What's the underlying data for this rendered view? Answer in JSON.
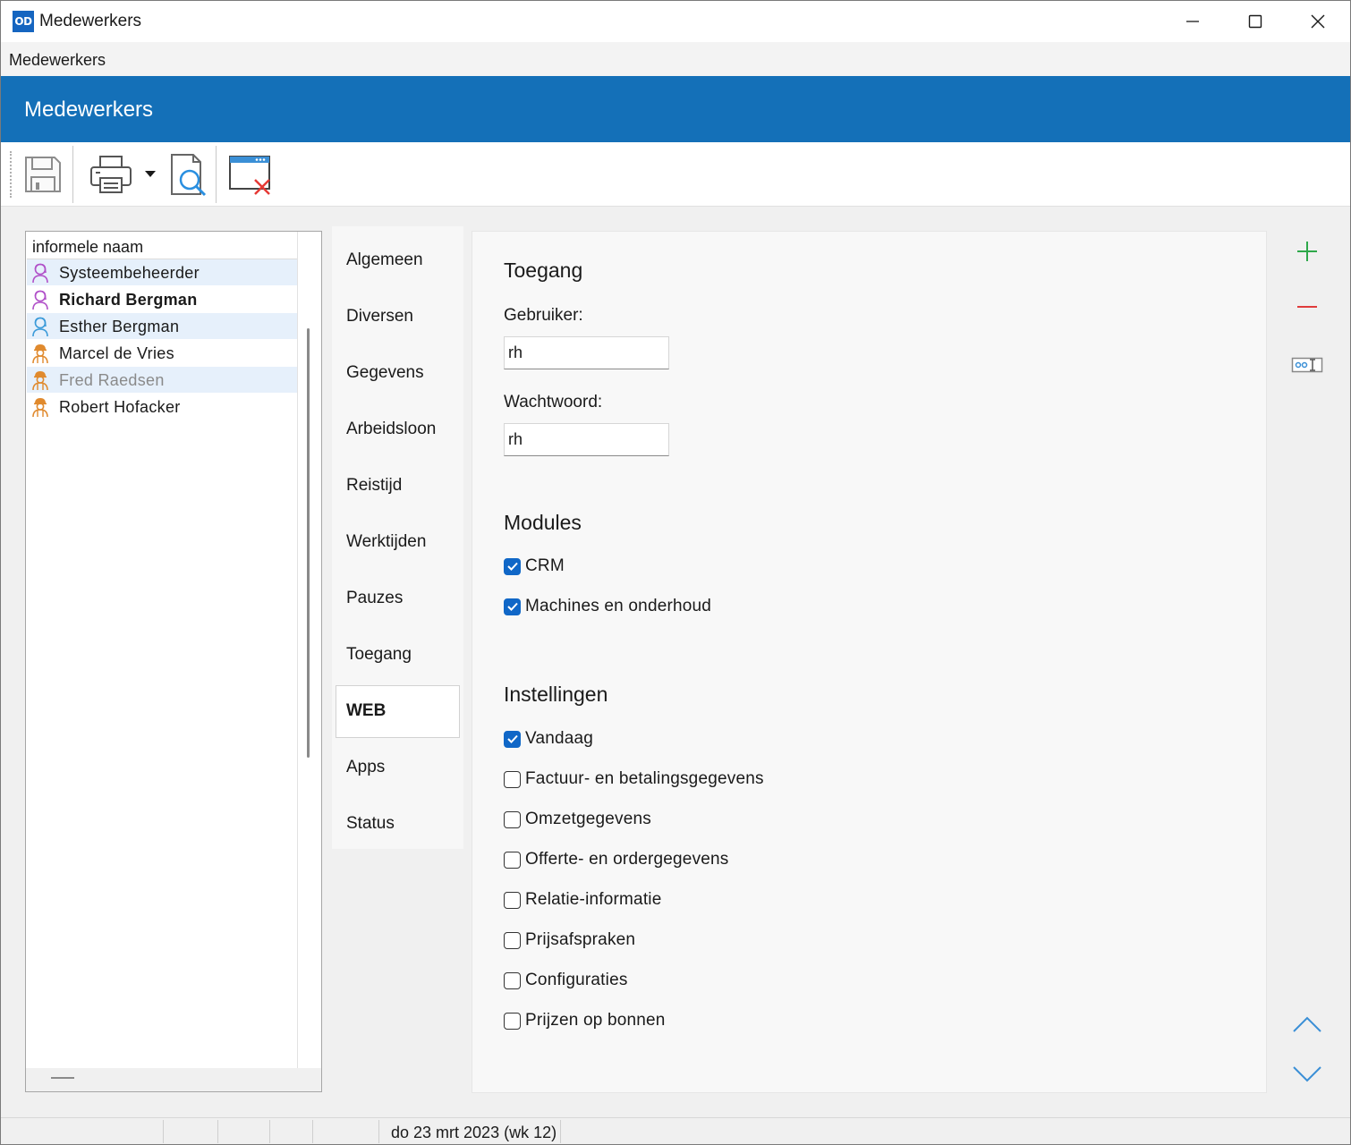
{
  "window": {
    "app_logo": "OD",
    "title": "Medewerkers"
  },
  "menu": {
    "items": [
      "Medewerkers"
    ]
  },
  "header": {
    "title": "Medewerkers"
  },
  "toolbar": {
    "buttons": [
      {
        "name": "save",
        "icon": "save-icon"
      },
      {
        "name": "print",
        "icon": "printer-icon"
      },
      {
        "name": "print-dropdown",
        "icon": "chevron-down-icon"
      },
      {
        "name": "print-preview",
        "icon": "preview-icon"
      },
      {
        "name": "close-window",
        "icon": "close-window-icon"
      }
    ]
  },
  "employee_list": {
    "column_header": "informele naam",
    "rows": [
      {
        "name": "Systeembeheerder",
        "style": "normal",
        "icon_color": "#b04fc8",
        "icon": "person-female-icon"
      },
      {
        "name": "Richard Bergman",
        "style": "bold",
        "icon_color": "#b04fc8",
        "icon": "person-female-icon"
      },
      {
        "name": "Esther Bergman",
        "style": "normal",
        "icon_color": "#3a9ad9",
        "icon": "person-female-icon"
      },
      {
        "name": "Marcel de Vries",
        "style": "normal",
        "icon_color": "#e08a2e",
        "icon": "worker-icon"
      },
      {
        "name": "Fred Raedsen",
        "style": "grey",
        "icon_color": "#e08a2e",
        "icon": "worker-icon"
      },
      {
        "name": "Robert Hofacker",
        "style": "normal",
        "icon_color": "#e08a2e",
        "icon": "worker-icon"
      }
    ]
  },
  "tabs": [
    {
      "label": "Algemeen",
      "active": false
    },
    {
      "label": "Diversen",
      "active": false
    },
    {
      "label": "Gegevens",
      "active": false
    },
    {
      "label": "Arbeidsloon",
      "active": false
    },
    {
      "label": "Reistijd",
      "active": false
    },
    {
      "label": "Werktijden",
      "active": false
    },
    {
      "label": "Pauzes",
      "active": false
    },
    {
      "label": "Toegang",
      "active": false
    },
    {
      "label": "WEB",
      "active": true
    },
    {
      "label": "Apps",
      "active": false
    },
    {
      "label": "Status",
      "active": false
    }
  ],
  "web": {
    "access_title": "Toegang",
    "user_label": "Gebruiker:",
    "user_value": "rh",
    "password_label": "Wachtwoord:",
    "password_value": "rh",
    "modules_title": "Modules",
    "modules": [
      {
        "label": "CRM",
        "checked": true
      },
      {
        "label": "Machines en onderhoud",
        "checked": true
      }
    ],
    "settings_title": "Instellingen",
    "settings": [
      {
        "label": "Vandaag",
        "checked": true
      },
      {
        "label": "Factuur- en betalingsgegevens",
        "checked": false
      },
      {
        "label": "Omzetgegevens",
        "checked": false
      },
      {
        "label": "Offerte- en ordergegevens",
        "checked": false
      },
      {
        "label": "Relatie-informatie",
        "checked": false
      },
      {
        "label": "Prijsafspraken",
        "checked": false
      },
      {
        "label": "Configuraties",
        "checked": false
      },
      {
        "label": "Prijzen op bonnen",
        "checked": false
      }
    ]
  },
  "actions": {
    "add_icon": "plus-icon",
    "remove_icon": "minus-icon",
    "rename_icon": "rename-field-icon",
    "up_icon": "chevron-up-icon",
    "down_icon": "chevron-down-icon",
    "add_color": "#2ea84a",
    "remove_color": "#e03c3c",
    "nav_color": "#3a8fd6"
  },
  "status": {
    "date_text": "do 23 mrt 2023 (wk 12)"
  }
}
